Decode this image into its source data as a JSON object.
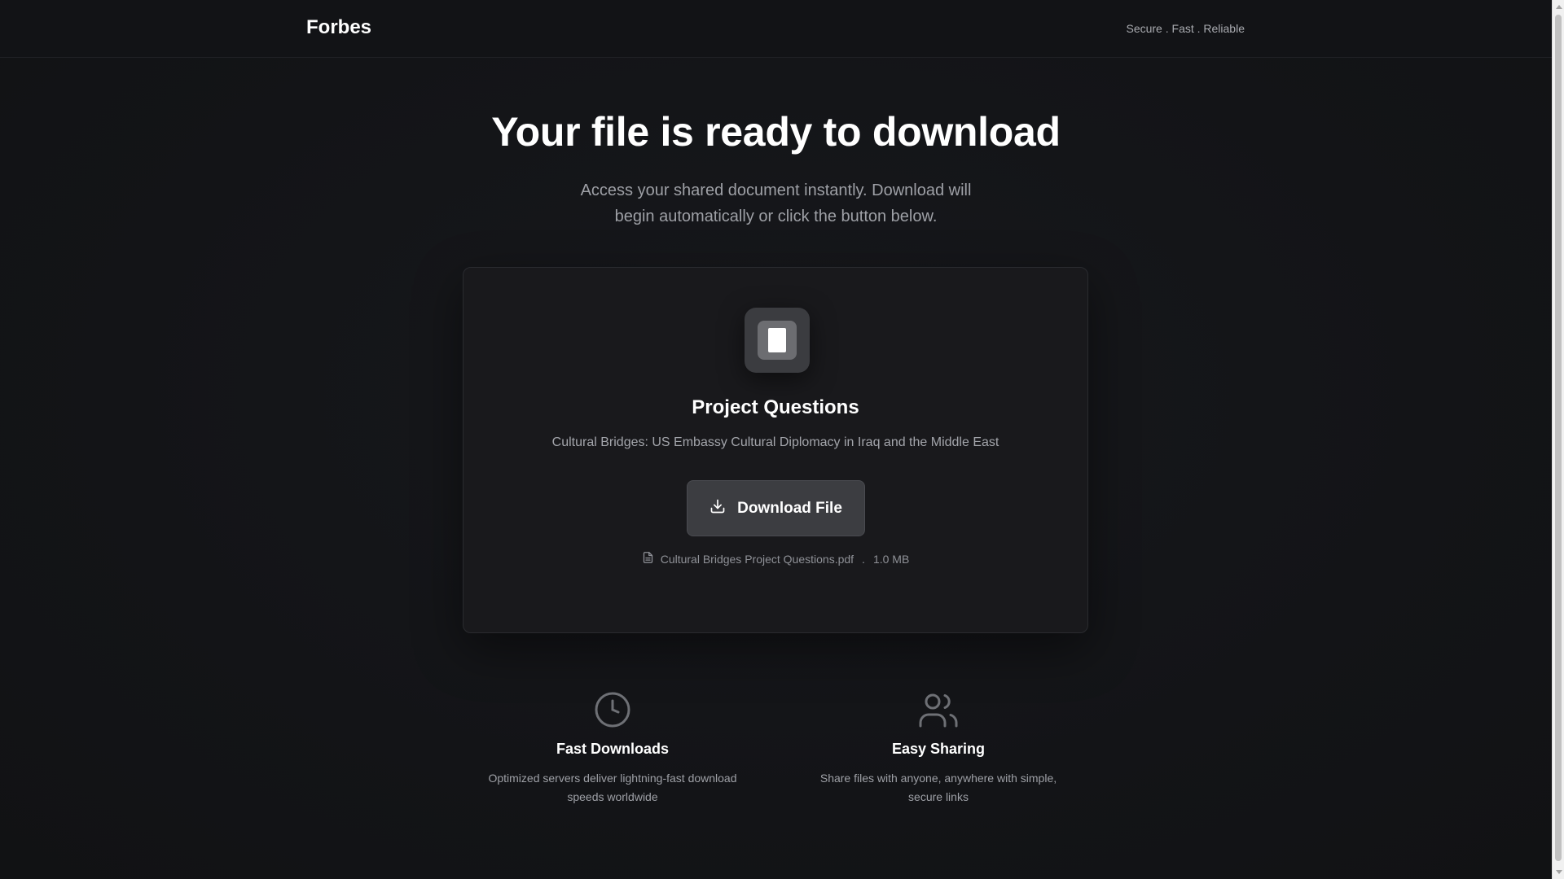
{
  "header": {
    "brand": "Forbes",
    "tagline": "Secure . Fast . Reliable"
  },
  "hero": {
    "title": "Your file is ready to download",
    "subtitle_line1": "Access your shared document instantly. Download will",
    "subtitle_line2": "begin automatically or click the button below."
  },
  "card": {
    "icon": "document-icon",
    "title": "Project Questions",
    "description": "Cultural Bridges: US Embassy Cultural Diplomacy in Iraq and the Middle East",
    "download_label": "Download File",
    "download_icon": "download-icon",
    "file_icon": "file-text-icon",
    "file_name": "Cultural Bridges Project Questions.pdf",
    "separator": ".",
    "file_size": "1.0 MB"
  },
  "features": [
    {
      "icon": "clock-icon",
      "title": "Fast Downloads",
      "description": "Optimized servers deliver lightning-fast download speeds worldwide"
    },
    {
      "icon": "users-icon",
      "title": "Easy Sharing",
      "description": "Share files with anyone, anywhere with simple, secure links"
    }
  ],
  "colors": {
    "background": "#141518",
    "card": "#19191c",
    "button": "#3c3d41",
    "text_muted": "#9ea0a6"
  }
}
